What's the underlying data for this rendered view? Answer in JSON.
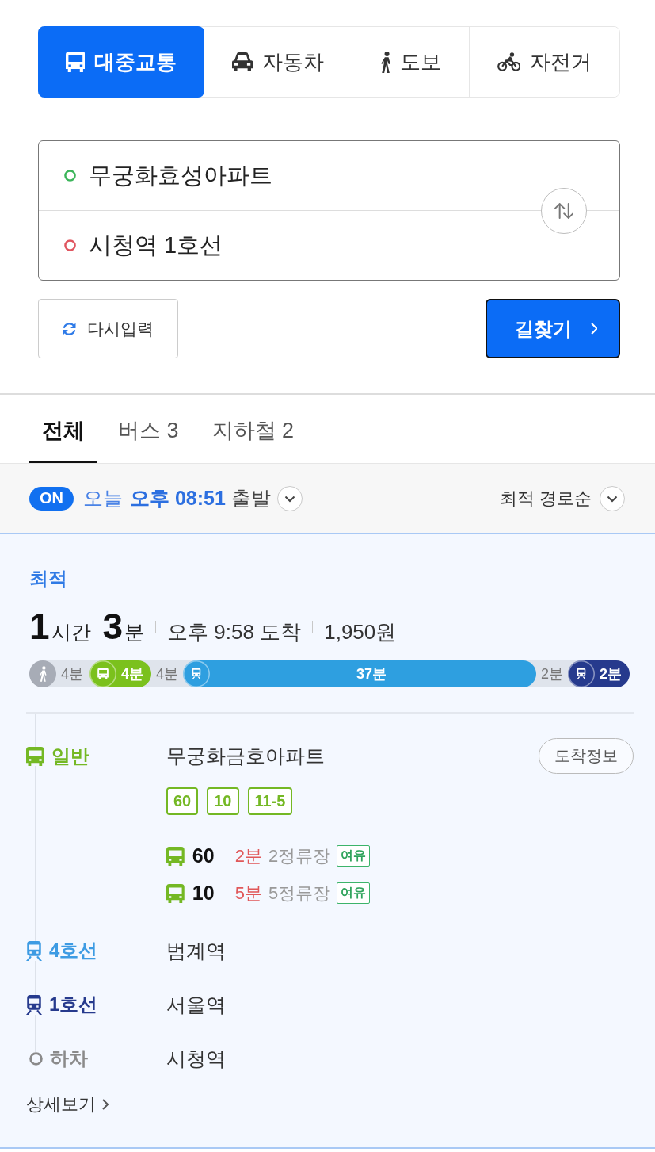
{
  "mode_tabs": [
    {
      "kind": "transit",
      "label": "대중교통",
      "selected": true
    },
    {
      "kind": "car",
      "label": "자동차",
      "selected": false
    },
    {
      "kind": "walk",
      "label": "도보",
      "selected": false
    },
    {
      "kind": "bike",
      "label": "자전거",
      "selected": false
    }
  ],
  "route_input": {
    "origin": "무궁화효성아파트",
    "destination": "시청역 1호선"
  },
  "actions": {
    "reset": "다시입력",
    "search": "길찾기"
  },
  "result_tabs": [
    {
      "label": "전체",
      "selected": true
    },
    {
      "label": "버스 3",
      "selected": false
    },
    {
      "label": "지하철 2",
      "selected": false
    }
  ],
  "departure": {
    "toggle": "ON",
    "on": true,
    "day": "오늘",
    "time": "오후 08:51",
    "suffix": "출발",
    "sort": "최적 경로순"
  },
  "route": {
    "tag": "최적",
    "duration": "**1**시간 **3**분",
    "arrival": "오후 9:58 도착",
    "fare": "1,950원",
    "segments": [
      {
        "kind": "walk",
        "label": "4분"
      },
      {
        "kind": "bus",
        "label": "4분",
        "color": "#7bc11d"
      },
      {
        "kind": "transfer",
        "label": "4분"
      },
      {
        "kind": "subway",
        "label": "37분",
        "color": "#2e9fe0"
      },
      {
        "kind": "transfer",
        "label": "2분"
      },
      {
        "kind": "subway",
        "label": "2분",
        "color": "#263a8d"
      }
    ],
    "steps": [
      {
        "kind": "bus",
        "mode": "일반",
        "color": "#74b824",
        "station": "무궁화금호아파트",
        "info_button": "도착정보",
        "routes": [
          "60",
          "10",
          "11-5"
        ],
        "arrivals": [
          {
            "number": "60",
            "eta": "2분",
            "stops": "2정류장",
            "crowding": "여유"
          },
          {
            "number": "10",
            "eta": "5분",
            "stops": "5정류장",
            "crowding": "여유"
          }
        ]
      },
      {
        "kind": "subway",
        "mode": "4호선",
        "color": "#3d9be3",
        "station": "범계역"
      },
      {
        "kind": "subway",
        "mode": "1호선",
        "color": "#263a8d",
        "station": "서울역"
      },
      {
        "kind": "alight",
        "mode": "하차",
        "station": "시청역"
      }
    ],
    "details_link": "상세보기"
  }
}
